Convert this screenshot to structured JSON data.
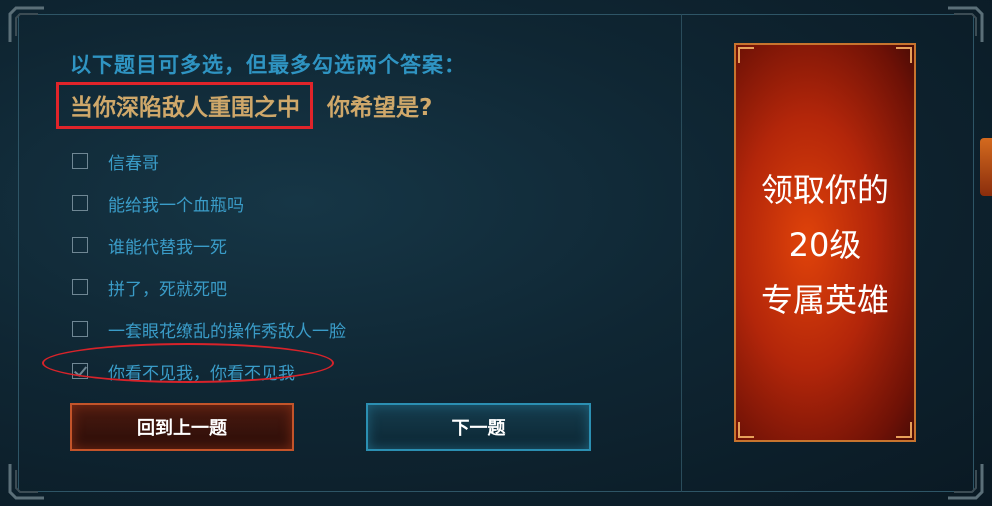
{
  "quiz": {
    "instruction": "以下题目可多选，但最多勾选两个答案：",
    "question_highlight": "当你深陷敌人重围之中",
    "question_rest": "你希望是?",
    "options": [
      {
        "label": "信春哥",
        "checked": false
      },
      {
        "label": "能给我一个血瓶吗",
        "checked": false
      },
      {
        "label": "谁能代替我一死",
        "checked": false
      },
      {
        "label": "拼了，死就死吧",
        "checked": false
      },
      {
        "label": "一套眼花缭乱的操作秀敌人一脸",
        "checked": false
      },
      {
        "label": "你看不见我，你看不见我",
        "checked": true
      }
    ]
  },
  "buttons": {
    "prev_label": "回到上一题",
    "next_label": "下一题"
  },
  "promo": {
    "line1": "领取你的",
    "line2": "20级",
    "line3": "专属英雄"
  },
  "colors": {
    "highlight_red": "#e0242a",
    "question_gold": "#cfa86a",
    "instruction_blue": "#2f94c2",
    "promo_orange": "#d8430a"
  }
}
